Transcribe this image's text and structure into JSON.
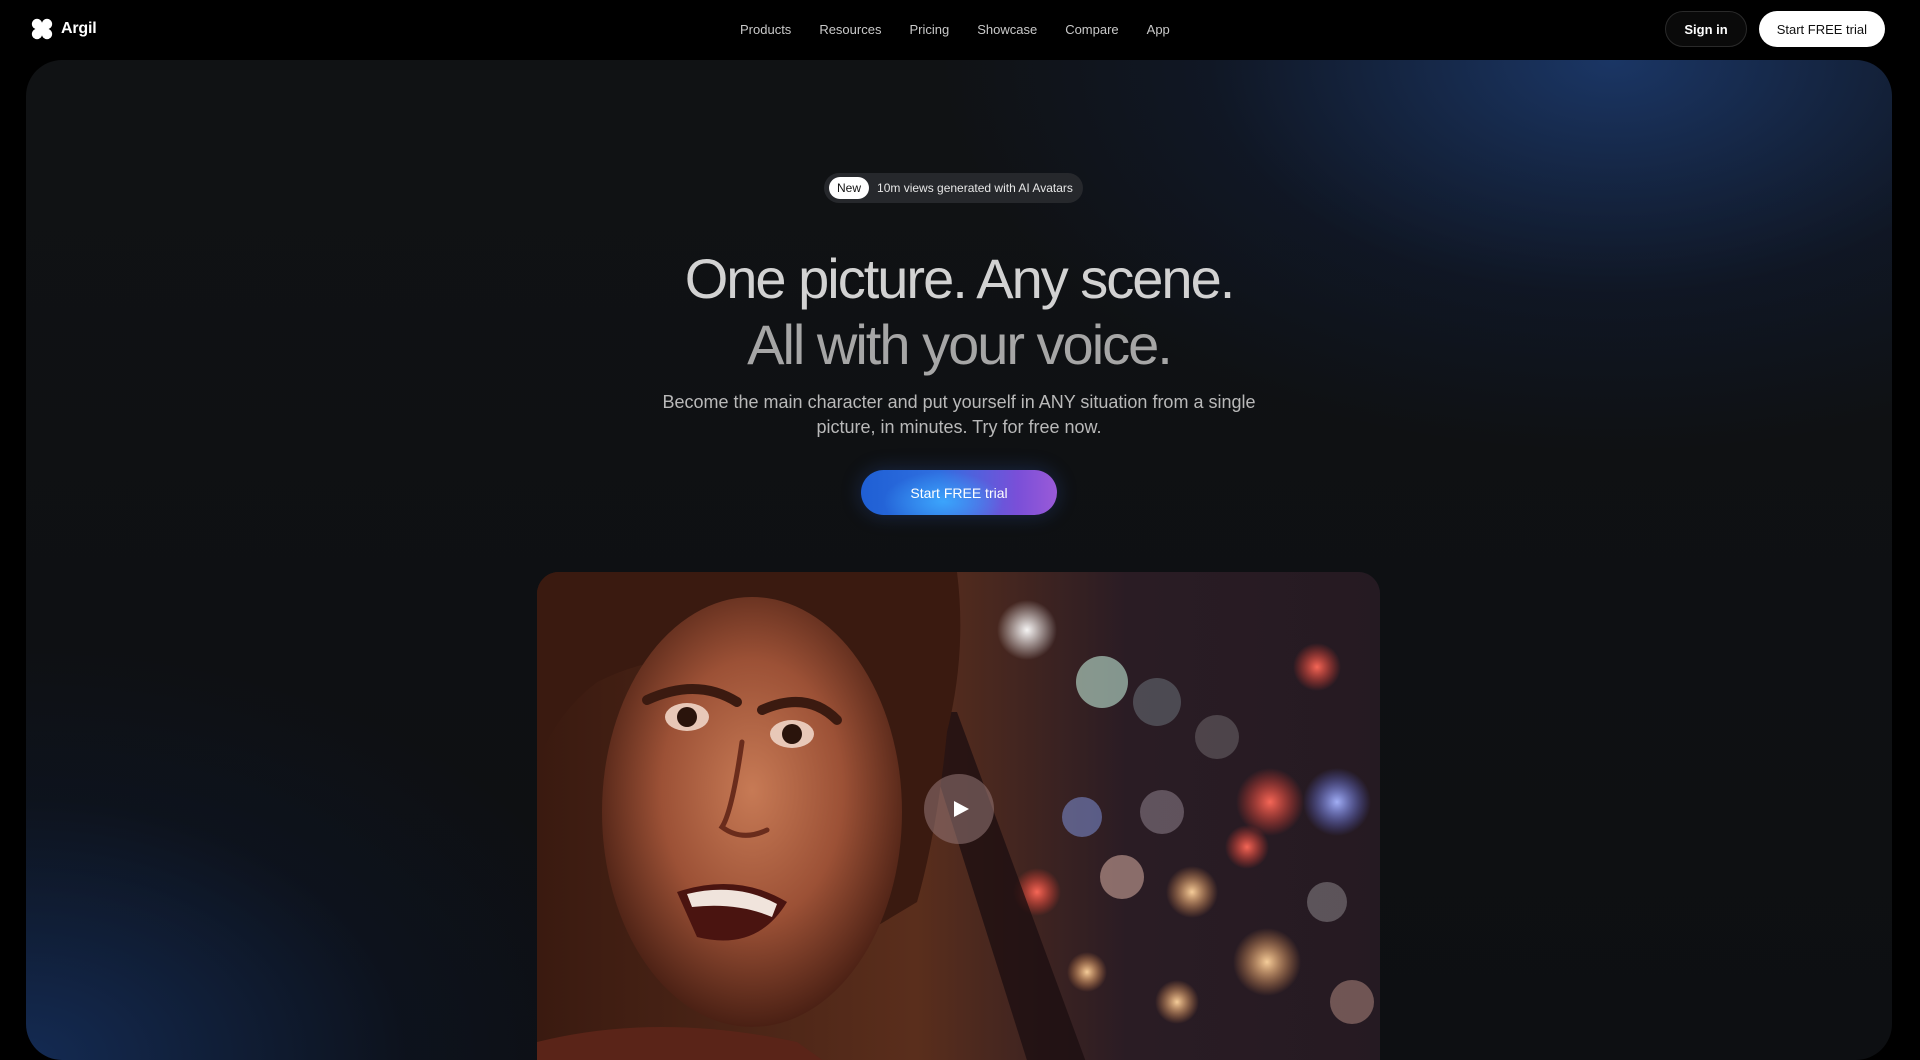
{
  "brand": {
    "name": "Argil",
    "logo_icon": "argil-logo-icon"
  },
  "nav": {
    "links": [
      "Products",
      "Resources",
      "Pricing",
      "Showcase",
      "Compare",
      "App"
    ],
    "sign_in": "Sign in",
    "start_trial": "Start FREE trial"
  },
  "hero": {
    "badge_pill": "New",
    "badge_text": "10m views generated with AI Avatars",
    "headline_line1": "One picture. Any scene.",
    "headline_line2": "All with your voice.",
    "subtitle": "Become the main character and put yourself in ANY situation from a single picture, in minutes. Try for free now.",
    "cta": "Start FREE trial"
  },
  "video": {
    "play_icon": "play-icon"
  },
  "colors": {
    "background": "#000000",
    "panel": "#0f1114",
    "accent_blue": "#2f6fe0",
    "accent_purple": "#9a5ad8",
    "button_white": "#ffffff"
  }
}
